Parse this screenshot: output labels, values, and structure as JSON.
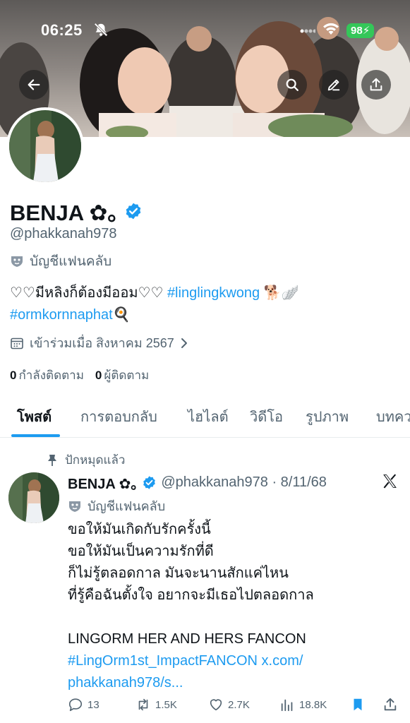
{
  "status_bar": {
    "time": "06:25",
    "battery": "98"
  },
  "profile": {
    "display_name": "BENJA ✿｡",
    "handle": "@phakkanah978",
    "label": "บัญชีแฟนคลับ",
    "bio_line1_text": "♡♡มีหลิงก็ต้องมีออม♡♡ ",
    "bio_hashtag1": "#linglingkwong",
    "bio_emoji1": " 🐕🪽",
    "bio_hashtag2": "#ormkornnaphat",
    "bio_emoji2": "🍳",
    "joined": "เข้าร่วมเมื่อ สิงหาคม 2567",
    "following_count": "0",
    "following_label": "กำลังติดตาม",
    "followers_count": "0",
    "followers_label": "ผู้ติดตาม"
  },
  "tabs": [
    "โพสต์",
    "การตอบกลับ",
    "ไฮไลต์",
    "วิดีโอ",
    "รูปภาพ",
    "บทความ"
  ],
  "post": {
    "pinned_label": "ปักหมุดแล้ว",
    "author_name": "BENJA ✿｡",
    "author_handle_date": "@phakkanah978 · 8/11/68",
    "author_label": "บัญชีแฟนคลับ",
    "lines": [
      "ขอให้มันเกิดกับรักครั้งนี้",
      "ขอให้มันเป็นความรักที่ดี",
      "ก็ไม่รู้ตลอดกาล มันจะนานสักแค่ไหน",
      "ที่รู้คือฉันตั้งใจ อยากจะมีเธอไปตลอดกาล",
      "",
      "LINGORM HER AND HERS FANCON"
    ],
    "link_hashtag": "#LingOrm1st_ImpactFANCON",
    "link_url_1": " x.com/",
    "link_url_2": "phakkanah978/s...",
    "replies": "13",
    "reposts": "1.5K",
    "likes": "2.7K",
    "views": "18.8K"
  },
  "colors": {
    "accent": "#1d9bf0",
    "secondary_text": "#536471",
    "battery": "#34c759"
  }
}
